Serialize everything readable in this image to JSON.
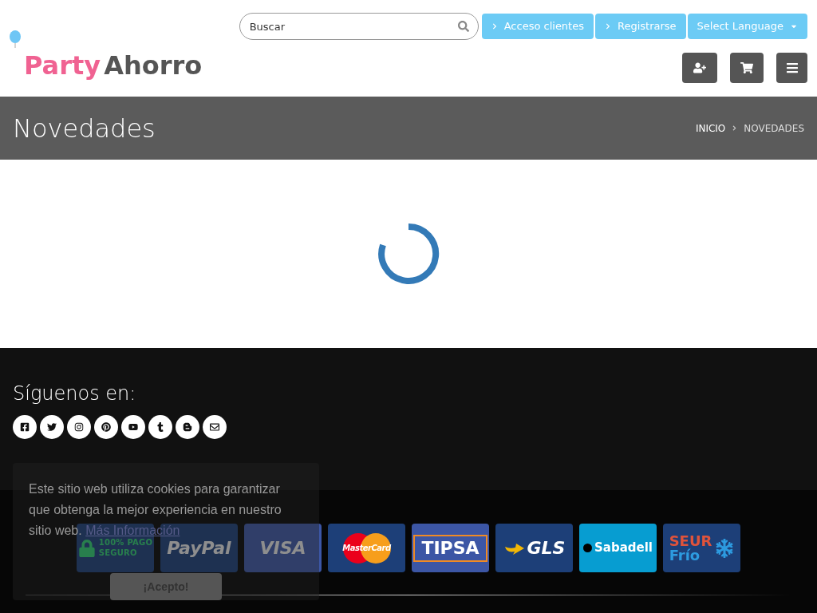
{
  "logo": {
    "word1": "Party",
    "word2": "Ahorro"
  },
  "search": {
    "placeholder": "Buscar"
  },
  "top_buttons": [
    {
      "label": "Acceso clientes",
      "kind": "link"
    },
    {
      "label": "Registrarse",
      "kind": "link"
    },
    {
      "label": "Select Language",
      "kind": "dropdown"
    }
  ],
  "page_title": "Novedades",
  "breadcrumb": [
    {
      "label": "INICIO",
      "selected": false
    },
    {
      "label": "NOVEDADES",
      "selected": true
    }
  ],
  "footer": {
    "follow_title": "Síguenos en:",
    "social": [
      {
        "kind": "facebook"
      },
      {
        "kind": "twitter"
      },
      {
        "kind": "instagram"
      },
      {
        "kind": "pinterest"
      },
      {
        "kind": "youtube"
      },
      {
        "kind": "tumblr"
      },
      {
        "kind": "blogger"
      },
      {
        "kind": "email"
      }
    ],
    "payments": [
      {
        "kind": "secure",
        "lines": [
          "100% PAGO",
          "SEGURO"
        ]
      },
      {
        "kind": "paypal",
        "lines": [
          "PayPal"
        ]
      },
      {
        "kind": "visa",
        "lines": [
          "VISA"
        ]
      },
      {
        "kind": "mastercard",
        "lines": [
          "MasterCard"
        ]
      },
      {
        "kind": "tipsa",
        "lines": [
          "TIPSA"
        ]
      },
      {
        "kind": "gls",
        "lines": [
          "GLS"
        ]
      },
      {
        "kind": "sabadell",
        "lines": [
          "Sabadell"
        ]
      },
      {
        "kind": "seur",
        "lines": [
          "SEUR",
          "Frío"
        ]
      }
    ]
  },
  "cookie_banner": {
    "text": "Este sitio web utiliza cookies para garantizar que obtenga la mejor experiencia en nuestro sitio web.",
    "link": "Más Información",
    "button": "¡Acepto!"
  }
}
